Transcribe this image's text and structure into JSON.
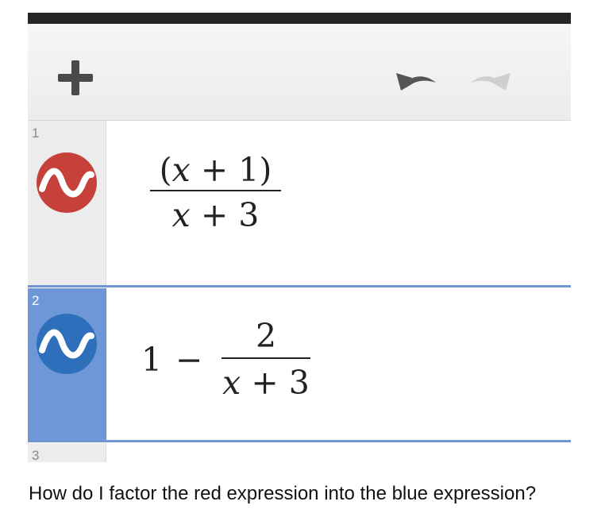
{
  "toolbar": {
    "add_icon": "plus-icon",
    "undo_icon": "undo-arrow-icon",
    "redo_icon": "redo-arrow-icon"
  },
  "expressions": [
    {
      "number": "1",
      "color": "#c7413b",
      "icon": "graph-wave-icon",
      "numerator": {
        "open": "(",
        "var": "x",
        "rest": " + 1",
        "close": ")"
      },
      "denominator": {
        "var": "x",
        "rest": " + 3"
      }
    },
    {
      "number": "2",
      "color": "#2d6fba",
      "icon": "graph-wave-icon",
      "lead": "1",
      "operator": "−",
      "numerator": "2",
      "denominator": {
        "var": "x",
        "rest": " + 3"
      }
    },
    {
      "number": "3"
    }
  ],
  "colors": {
    "topbar": "#262626",
    "selected_gutter": "#6d97d6",
    "divider": "#6f96d1"
  },
  "caption": "How do I factor the red expression into the blue expression?"
}
